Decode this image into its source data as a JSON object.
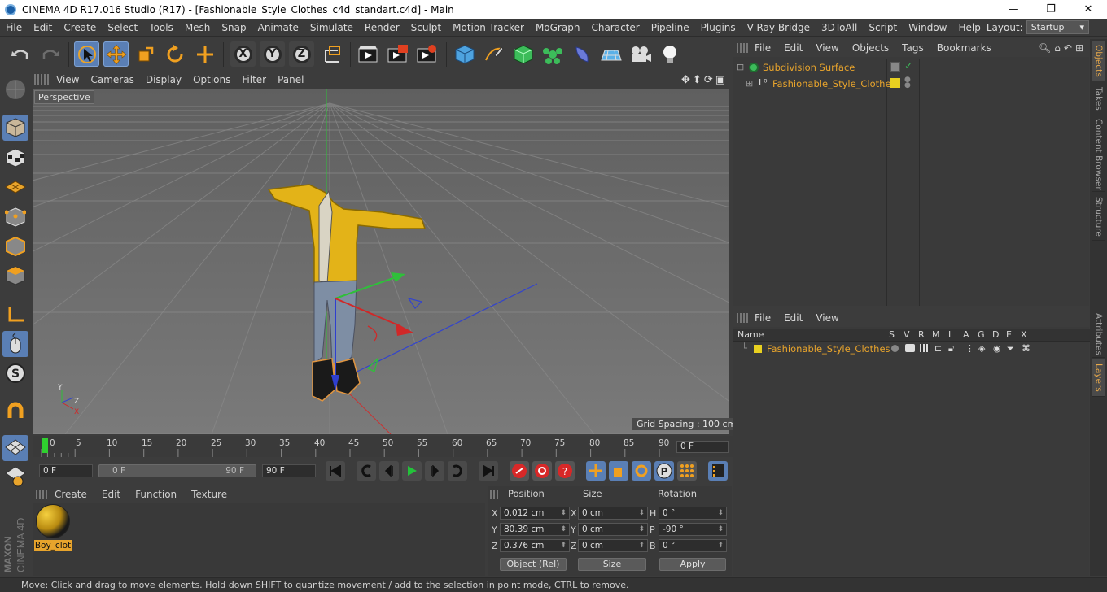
{
  "window": {
    "title": "CINEMA 4D R17.016 Studio (R17) - [Fashionable_Style_Clothes_c4d_standart.c4d] - Main",
    "controls": [
      "—",
      "❐",
      "✕"
    ]
  },
  "menubar": {
    "items": [
      "File",
      "Edit",
      "Create",
      "Select",
      "Tools",
      "Mesh",
      "Snap",
      "Animate",
      "Simulate",
      "Render",
      "Sculpt",
      "Motion Tracker",
      "MoGraph",
      "Character",
      "Pipeline",
      "Plugins",
      "V-Ray Bridge",
      "3DToAll",
      "Script",
      "Window",
      "Help"
    ],
    "layout_label": "Layout:",
    "layout_value": "Startup"
  },
  "toolbar": {
    "axis_x": "X",
    "axis_y": "Y",
    "axis_z": "Z"
  },
  "viewport": {
    "menu": [
      "View",
      "Cameras",
      "Display",
      "Options",
      "Filter",
      "Panel"
    ],
    "label": "Perspective",
    "grid_spacing": "Grid Spacing : 100 cm",
    "axis_labels": {
      "x": "X",
      "y": "Y",
      "z": "Z"
    }
  },
  "timeline": {
    "ticks": [
      "0",
      "5",
      "10",
      "15",
      "20",
      "25",
      "30",
      "35",
      "40",
      "45",
      "50",
      "55",
      "60",
      "65",
      "70",
      "75",
      "80",
      "85",
      "90"
    ],
    "current_frame": "0 F"
  },
  "transport": {
    "start_frame": "0 F",
    "range_start": "0 F",
    "range_end": "90 F",
    "end_frame": "90 F"
  },
  "material_manager": {
    "menu": [
      "Create",
      "Edit",
      "Function",
      "Texture"
    ],
    "material_name": "Boy_clot"
  },
  "coordinates": {
    "headers": {
      "position": "Position",
      "size": "Size",
      "rotation": "Rotation"
    },
    "rows": [
      {
        "axis": "X",
        "pos": "0.012 cm",
        "size_axis": "X",
        "size": "0 cm",
        "rot_axis": "H",
        "rot": "0 °"
      },
      {
        "axis": "Y",
        "pos": "80.39 cm",
        "size_axis": "Y",
        "size": "0 cm",
        "rot_axis": "P",
        "rot": "-90 °"
      },
      {
        "axis": "Z",
        "pos": "0.376 cm",
        "size_axis": "Z",
        "size": "0 cm",
        "rot_axis": "B",
        "rot": "0 °"
      }
    ],
    "mode": "Object (Rel)",
    "size_mode": "Size",
    "apply": "Apply"
  },
  "object_manager": {
    "menu": [
      "File",
      "Edit",
      "View",
      "Objects",
      "Tags",
      "Bookmarks"
    ],
    "objects": [
      {
        "name": "Subdivision Surface"
      },
      {
        "name": "Fashionable_Style_Clothes"
      }
    ]
  },
  "layer_manager": {
    "menu": [
      "File",
      "Edit",
      "View"
    ],
    "columns": [
      "Name",
      "S",
      "V",
      "R",
      "M",
      "L",
      "A",
      "G",
      "D",
      "E",
      "X"
    ],
    "layers": [
      {
        "name": "Fashionable_Style_Clothes",
        "color": "#e8d020"
      }
    ]
  },
  "side_tabs": [
    "Objects",
    "Takes",
    "Content Browser",
    "Structure",
    "Attributes",
    "Layers"
  ],
  "brand": {
    "maxon": "MAXON",
    "product": "CINEMA 4D"
  },
  "status": "Move: Click and drag to move elements. Hold down SHIFT to quantize movement / add to the selection in point mode, CTRL to remove.",
  "colors": {
    "accent": "#5a7fb5",
    "highlight": "#e8a42c",
    "jacket": "#e3b318"
  }
}
